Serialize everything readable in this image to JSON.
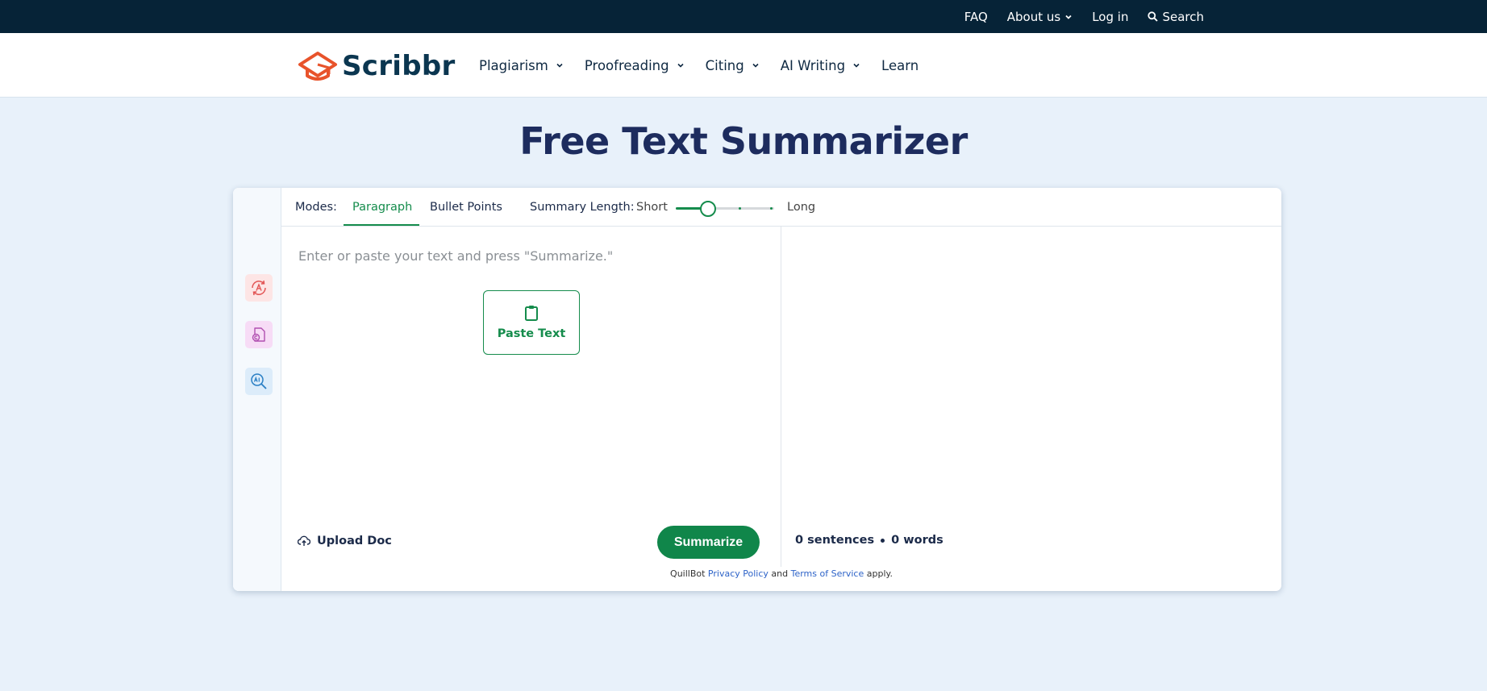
{
  "topbar": {
    "faq": "FAQ",
    "about": "About us",
    "login": "Log in",
    "search": "Search"
  },
  "brand": {
    "name": "Scribbr"
  },
  "nav": {
    "items": [
      {
        "label": "Plagiarism",
        "dropdown": true
      },
      {
        "label": "Proofreading",
        "dropdown": true
      },
      {
        "label": "Citing",
        "dropdown": true
      },
      {
        "label": "AI Writing",
        "dropdown": true
      },
      {
        "label": "Learn",
        "dropdown": false
      }
    ]
  },
  "page": {
    "title": "Free Text Summarizer"
  },
  "sidebar": {
    "icons": [
      "paraphrase-icon",
      "citation-icon",
      "ai-detector-icon"
    ]
  },
  "modes": {
    "label": "Modes:",
    "tabs": [
      {
        "label": "Paragraph",
        "active": true
      },
      {
        "label": "Bullet Points",
        "active": false
      }
    ]
  },
  "length": {
    "label": "Summary Length:",
    "short": "Short",
    "long": "Long",
    "value": 0.33
  },
  "input": {
    "placeholder": "Enter or paste your text and press \"Summarize.\"",
    "paste_label": "Paste Text",
    "upload_label": "Upload Doc",
    "summarize_label": "Summarize"
  },
  "output": {
    "sentences": "0 sentences",
    "words": "0 words"
  },
  "legal": {
    "prefix": "QuillBot",
    "privacy": "Privacy Policy",
    "and": "and",
    "terms": "Terms of Service",
    "suffix": "apply."
  },
  "colors": {
    "accent": "#158c4c",
    "brand_orange": "#e8532b",
    "topbar_bg": "#062337",
    "page_bg": "#e8f1fa"
  }
}
